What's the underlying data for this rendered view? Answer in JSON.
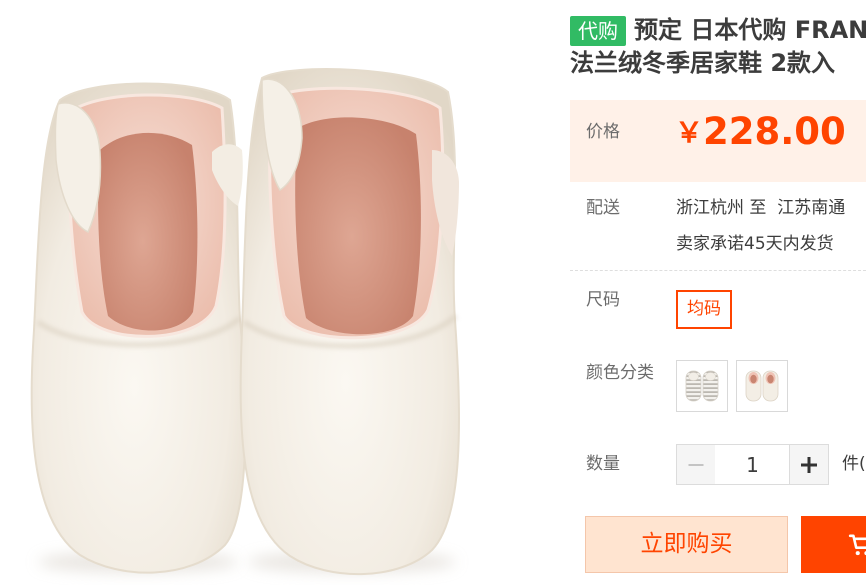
{
  "colors": {
    "accent": "#ff4400",
    "badge_green": "#31bb64",
    "price_background": "#fff1e8",
    "buy_now_background": "#ffe4d0",
    "label_gray": "#6c6c6c",
    "text_dark": "#3c3c3c"
  },
  "product_image": {
    "icon": "slipper-boots-photo"
  },
  "title": {
    "badge": "代购",
    "line1": "预定 日本代购 FRANC",
    "line2": "法兰绒冬季居家鞋 2款入"
  },
  "price": {
    "label": "价格",
    "currency": "￥",
    "amount": "228.00"
  },
  "delivery": {
    "label": "配送",
    "route": "浙江杭州 至  江苏南通",
    "promise": "卖家承诺45天内发货"
  },
  "size": {
    "label": "尺码",
    "options": [
      {
        "label": "均码",
        "selected": true
      }
    ]
  },
  "color": {
    "label": "颜色分类",
    "options": [
      {
        "icon": "striped-boots-thumbnail",
        "selected": false
      },
      {
        "icon": "pink-lined-boots-thumbnail",
        "selected": false
      }
    ]
  },
  "quantity": {
    "label": "数量",
    "value": "1",
    "unit": "件(",
    "minus_icon": "minus-icon",
    "plus_icon": "plus-icon",
    "minus_disabled": true
  },
  "actions": {
    "buy_now": "立即购买",
    "add_to_cart_icon": "cart-icon"
  }
}
